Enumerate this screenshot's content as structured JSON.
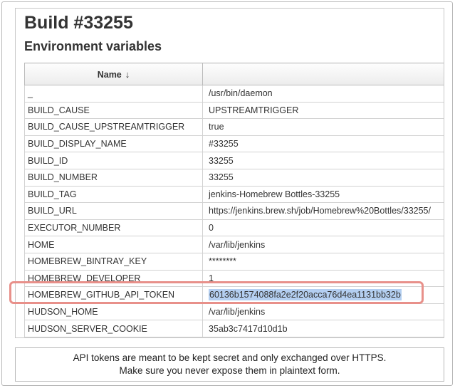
{
  "header": {
    "build_title": "Build #33255",
    "section_title": "Environment variables"
  },
  "table": {
    "columns": {
      "name": "Name",
      "sort_indicator": "↓",
      "value": ""
    },
    "rows": [
      {
        "name": "_",
        "value": "/usr/bin/daemon"
      },
      {
        "name": "BUILD_CAUSE",
        "value": "UPSTREAMTRIGGER"
      },
      {
        "name": "BUILD_CAUSE_UPSTREAMTRIGGER",
        "value": "true"
      },
      {
        "name": "BUILD_DISPLAY_NAME",
        "value": "#33255"
      },
      {
        "name": "BUILD_ID",
        "value": "33255"
      },
      {
        "name": "BUILD_NUMBER",
        "value": "33255"
      },
      {
        "name": "BUILD_TAG",
        "value": "jenkins-Homebrew Bottles-33255"
      },
      {
        "name": "BUILD_URL",
        "value": "https://jenkins.brew.sh/job/Homebrew%20Bottles/33255/"
      },
      {
        "name": "EXECUTOR_NUMBER",
        "value": "0"
      },
      {
        "name": "HOME",
        "value": "/var/lib/jenkins"
      },
      {
        "name": "HOMEBREW_BINTRAY_KEY",
        "value": "********"
      },
      {
        "name": "HOMEBREW_DEVELOPER",
        "value": "1"
      },
      {
        "name": "HOMEBREW_GITHUB_API_TOKEN",
        "value": "60136b1574088fa2e2f20acca76d4ea1131bb32b"
      },
      {
        "name": "HUDSON_HOME",
        "value": "/var/lib/jenkins"
      },
      {
        "name": "HUDSON_SERVER_COOKIE",
        "value": "35ab3c7417d10d1b"
      }
    ]
  },
  "annotation": {
    "highlight_color": "#e8908a",
    "selection_color": "#b4cff1"
  },
  "notice": {
    "line1": "API tokens are meant to be kept secret and only exchanged over HTTPS.",
    "line2": "Make sure you never expose them in plaintext form."
  }
}
